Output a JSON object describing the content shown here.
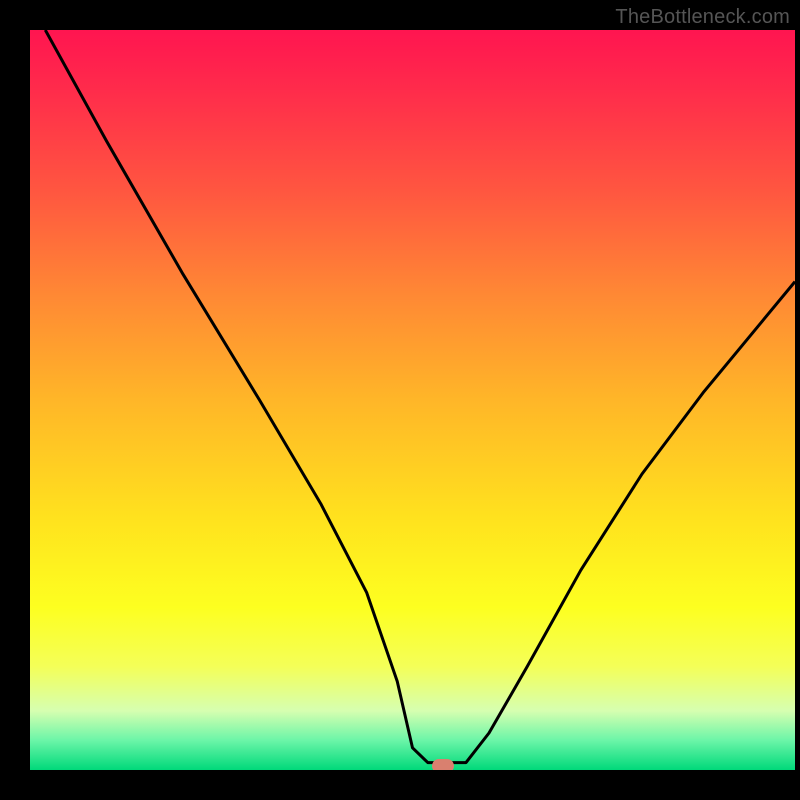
{
  "watermark": "TheBottleneck.com",
  "chart_data": {
    "type": "line",
    "title": "",
    "xlabel": "",
    "ylabel": "",
    "xlim": [
      0,
      100
    ],
    "ylim": [
      0,
      100
    ],
    "series": [
      {
        "name": "bottleneck-curve",
        "x": [
          2,
          10,
          20,
          30,
          38,
          44,
          48,
          50,
          52,
          54,
          57,
          60,
          65,
          72,
          80,
          88,
          96,
          100
        ],
        "values": [
          100,
          85,
          67,
          50,
          36,
          24,
          12,
          3,
          1,
          1,
          1,
          5,
          14,
          27,
          40,
          51,
          61,
          66
        ]
      }
    ],
    "marker": {
      "x": 54,
      "y": 0.5
    },
    "gradient_stops": [
      {
        "pct": 0,
        "color": "#ff1550"
      },
      {
        "pct": 8,
        "color": "#ff2b4b"
      },
      {
        "pct": 22,
        "color": "#ff5740"
      },
      {
        "pct": 36,
        "color": "#ff8934"
      },
      {
        "pct": 50,
        "color": "#ffb628"
      },
      {
        "pct": 66,
        "color": "#ffe21e"
      },
      {
        "pct": 78,
        "color": "#fdff20"
      },
      {
        "pct": 86,
        "color": "#f4ff58"
      },
      {
        "pct": 92,
        "color": "#d6ffb0"
      },
      {
        "pct": 96,
        "color": "#6bf5a8"
      },
      {
        "pct": 100,
        "color": "#00d97a"
      }
    ]
  }
}
